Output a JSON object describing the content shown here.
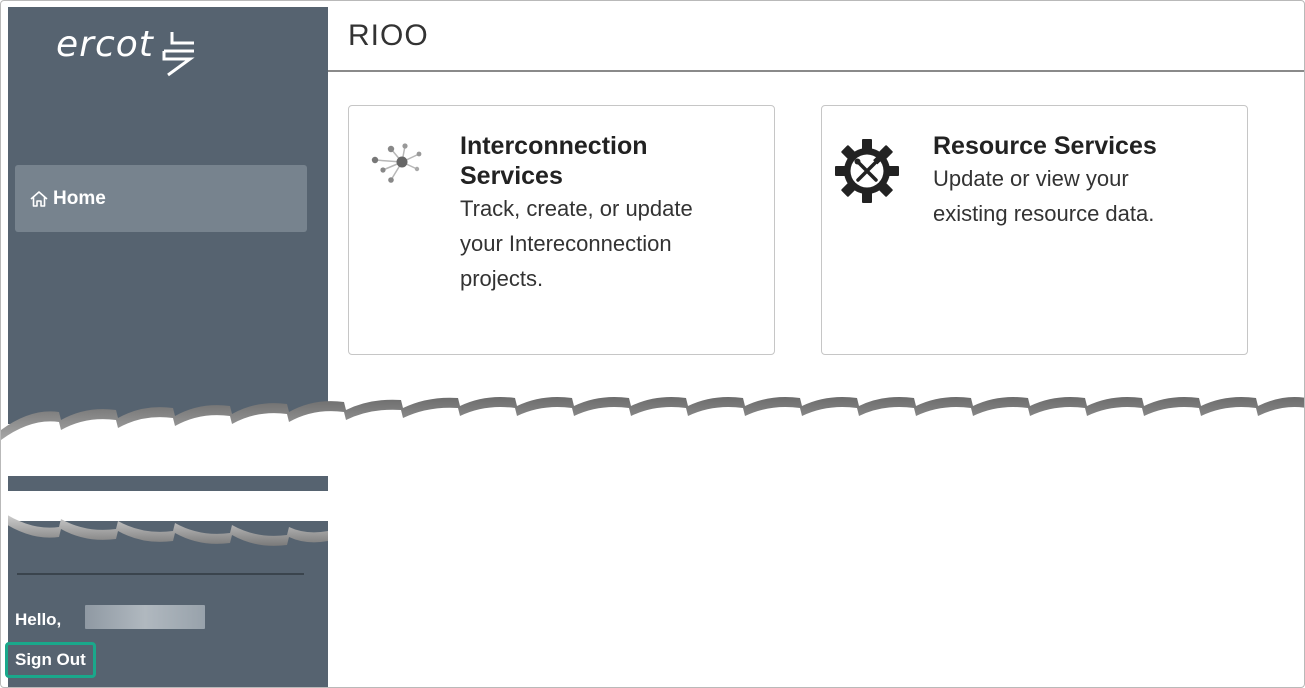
{
  "brand": {
    "logo_text": "ercot"
  },
  "header": {
    "title": "RIOO"
  },
  "sidebar": {
    "home_label": "Home",
    "greeting": "Hello,",
    "sign_out_label": "Sign Out"
  },
  "cards": [
    {
      "title_line1": "Interconnection",
      "title_line2": "Services",
      "desc_lines": [
        "Track, create, or update",
        "your Intereconnection",
        "projects."
      ],
      "icon": "network-icon"
    },
    {
      "title_line1": "Resource Services",
      "desc_lines": [
        "Update or view your",
        "existing resource data."
      ],
      "icon": "gear-tools-icon"
    }
  ],
  "colors": {
    "sidebar": "#566370",
    "home_active": "#77838e",
    "sign_out_highlight": "#1aa88b"
  }
}
